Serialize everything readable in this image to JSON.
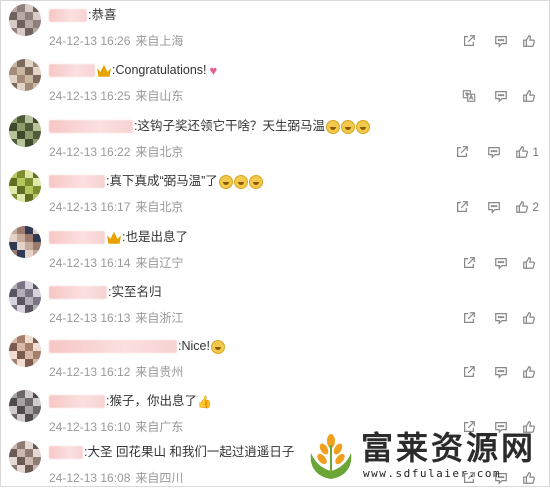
{
  "comments": [
    {
      "name_width": 38,
      "text": "恭喜",
      "emojis": 0,
      "badge": false,
      "heart": false,
      "thumb": false,
      "time": "24-12-13 16:26",
      "location": "来自上海",
      "translate": false,
      "likes": ""
    },
    {
      "name_width": 46,
      "text": "Congratulations!",
      "emojis": 0,
      "badge": true,
      "heart": true,
      "thumb": false,
      "time": "24-12-13 16:25",
      "location": "来自山东",
      "translate": true,
      "likes": ""
    },
    {
      "name_width": 84,
      "text": "这钩子奖还领它干啥？天生弼马温",
      "emojis": 3,
      "badge": false,
      "heart": false,
      "thumb": false,
      "time": "24-12-13 16:22",
      "location": "来自北京",
      "translate": false,
      "likes": "1"
    },
    {
      "name_width": 56,
      "text": "真下真成“弼马温”了",
      "emojis": 3,
      "badge": false,
      "heart": false,
      "thumb": false,
      "time": "24-12-13 16:17",
      "location": "来自北京",
      "translate": false,
      "likes": "2"
    },
    {
      "name_width": 56,
      "text": "也是出息了",
      "emojis": 0,
      "badge": true,
      "heart": false,
      "thumb": false,
      "time": "24-12-13 16:14",
      "location": "来自辽宁",
      "translate": false,
      "likes": ""
    },
    {
      "name_width": 58,
      "text": "实至名归",
      "emojis": 0,
      "badge": false,
      "heart": false,
      "thumb": false,
      "time": "24-12-13 16:13",
      "location": "来自浙江",
      "translate": false,
      "likes": ""
    },
    {
      "name_width": 128,
      "text": "Nice!",
      "emojis": 1,
      "badge": false,
      "heart": false,
      "thumb": false,
      "time": "24-12-13 16:12",
      "location": "来自贵州",
      "translate": false,
      "likes": ""
    },
    {
      "name_width": 56,
      "text": "猴子，你出息了",
      "emojis": 0,
      "badge": false,
      "heart": false,
      "thumb": true,
      "time": "24-12-13 16:10",
      "location": "来自广东",
      "translate": false,
      "likes": ""
    },
    {
      "name_width": 34,
      "text": "大圣 回花果山 和我们一起过逍遥日子",
      "emojis": 0,
      "badge": false,
      "heart": false,
      "thumb": false,
      "time": "24-12-13 16:08",
      "location": "来自四川",
      "translate": false,
      "likes": ""
    }
  ],
  "avatar_colors": [
    [
      "#b9a9a4",
      "#8e7f7c",
      "#d7cbc7",
      "#6f625e"
    ],
    [
      "#c9b6a3",
      "#7c6a5c",
      "#e2d4c5",
      "#a38b78"
    ],
    [
      "#8e9b6a",
      "#4f5b39",
      "#b7c39a",
      "#3e4a2e"
    ],
    [
      "#b6c65e",
      "#7c8f2f",
      "#dfe8a8",
      "#5f6e22"
    ],
    [
      "#c7a99a",
      "#9a7b6d",
      "#2f3a55",
      "#e3d2c8"
    ],
    [
      "#b3afb9",
      "#7a7484",
      "#d7d3dc",
      "#5a5563"
    ],
    [
      "#d9b8a6",
      "#a47f6d",
      "#f0dcd1",
      "#7a5b4d"
    ],
    [
      "#a7a2a4",
      "#6d6769",
      "#cfcacc",
      "#504a4c"
    ],
    [
      "#cbb9b0",
      "#8e7c73",
      "#e5d9d3",
      "#6c5b53"
    ]
  ],
  "watermark": {
    "title": "富莱资源网",
    "url": "www.sdfulaier.com"
  }
}
